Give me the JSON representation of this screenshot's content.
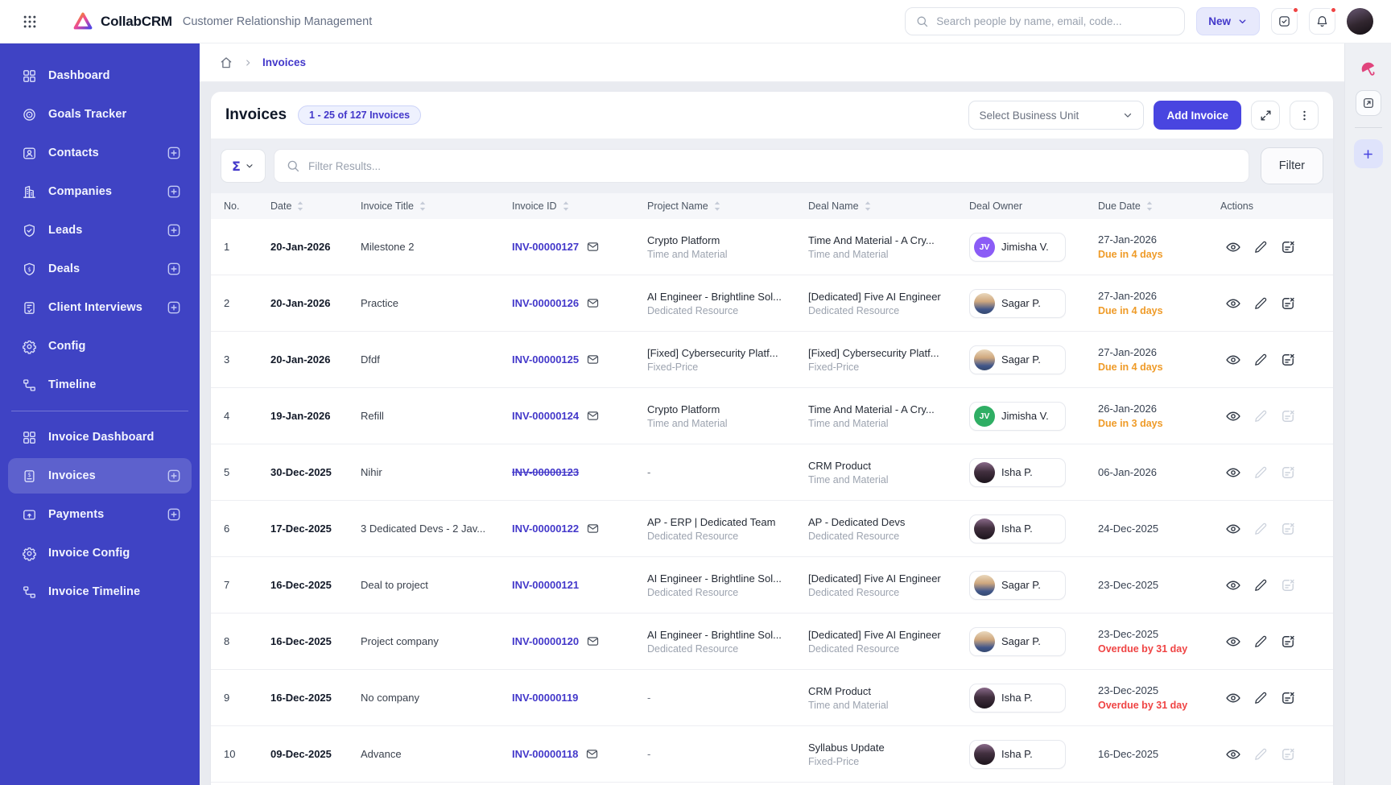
{
  "topbar": {
    "brand": "CollabCRM",
    "tagline": "Customer Relationship Management",
    "search_placeholder": "Search people by name, email, code...",
    "new_label": "New",
    "accent_color": "#4945e0",
    "notification_dot_color": "#ef4444"
  },
  "sidebar": {
    "background_color": "#3f43c4",
    "items": [
      {
        "label": "Dashboard",
        "icon": "dashboard-icon",
        "addable": false,
        "active": false
      },
      {
        "label": "Goals Tracker",
        "icon": "target-icon",
        "addable": false,
        "active": false
      },
      {
        "label": "Contacts",
        "icon": "contact-card-icon",
        "addable": true,
        "active": false
      },
      {
        "label": "Companies",
        "icon": "building-icon",
        "addable": true,
        "active": false
      },
      {
        "label": "Leads",
        "icon": "shield-check-icon",
        "addable": true,
        "active": false
      },
      {
        "label": "Deals",
        "icon": "shield-dollar-icon",
        "addable": true,
        "active": false
      },
      {
        "label": "Client Interviews",
        "icon": "document-check-icon",
        "addable": true,
        "active": false
      },
      {
        "label": "Config",
        "icon": "gear-icon",
        "addable": false,
        "active": false
      },
      {
        "label": "Timeline",
        "icon": "timeline-icon",
        "addable": false,
        "active": false
      },
      {
        "divider": true
      },
      {
        "label": "Invoice Dashboard",
        "icon": "dashboard-icon",
        "addable": false,
        "active": false
      },
      {
        "label": "Invoices",
        "icon": "invoice-icon",
        "addable": true,
        "active": true
      },
      {
        "label": "Payments",
        "icon": "payment-card-icon",
        "addable": true,
        "active": false
      },
      {
        "label": "Invoice Config",
        "icon": "gear-icon",
        "addable": false,
        "active": false
      },
      {
        "label": "Invoice Timeline",
        "icon": "timeline-icon",
        "addable": false,
        "active": false
      }
    ]
  },
  "breadcrumb": {
    "current": "Invoices"
  },
  "toolbar": {
    "title": "Invoices",
    "count_badge": "1 - 25 of 127 Invoices",
    "business_unit_placeholder": "Select Business Unit",
    "add_invoice_label": "Add Invoice"
  },
  "filterbar": {
    "sigma_glyph": "Σ",
    "placeholder": "Filter Results...",
    "filter_label": "Filter"
  },
  "table": {
    "columns": [
      {
        "label": "No.",
        "sortable": false
      },
      {
        "label": "Date",
        "sortable": true
      },
      {
        "label": "Invoice Title",
        "sortable": true
      },
      {
        "label": "Invoice ID",
        "sortable": true
      },
      {
        "label": "Project Name",
        "sortable": true
      },
      {
        "label": "Deal Name",
        "sortable": true
      },
      {
        "label": "Deal Owner",
        "sortable": false
      },
      {
        "label": "Due Date",
        "sortable": true
      },
      {
        "label": "Actions",
        "sortable": false
      }
    ],
    "status_colors": {
      "warn": "#ef9b28",
      "over": "#ef4444"
    },
    "rows": [
      {
        "no": "1",
        "date": "20-Jan-2026",
        "title": "Milestone 2",
        "invoice_id": "INV-00000127",
        "cancelled": false,
        "has_mail": true,
        "project_name": "Crypto Platform",
        "project_type": "Time and Material",
        "deal_name": "Time And Material - A Cry...",
        "deal_type": "Time and Material",
        "owner": {
          "name": "Jimisha V.",
          "avatar": "initials",
          "initials": "JV",
          "color": "#8b5cf6"
        },
        "due_date": "27-Jan-2026",
        "due_status": "Due in 4 days",
        "due_status_type": "warn",
        "actions": {
          "view": true,
          "edit": true,
          "cancel": true
        }
      },
      {
        "no": "2",
        "date": "20-Jan-2026",
        "title": "Practice",
        "invoice_id": "INV-00000126",
        "cancelled": false,
        "has_mail": true,
        "project_name": "AI Engineer - Brightline Sol...",
        "project_type": "Dedicated Resource",
        "deal_name": "[Dedicated] Five AI Engineer",
        "deal_type": "Dedicated Resource",
        "owner": {
          "name": "Sagar P.",
          "avatar": "photo-male"
        },
        "due_date": "27-Jan-2026",
        "due_status": "Due in 4 days",
        "due_status_type": "warn",
        "actions": {
          "view": true,
          "edit": true,
          "cancel": true
        }
      },
      {
        "no": "3",
        "date": "20-Jan-2026",
        "title": "Dfdf",
        "invoice_id": "INV-00000125",
        "cancelled": false,
        "has_mail": true,
        "project_name": "[Fixed] Cybersecurity Platf...",
        "project_type": "Fixed-Price",
        "deal_name": "[Fixed] Cybersecurity Platf...",
        "deal_type": "Fixed-Price",
        "owner": {
          "name": "Sagar P.",
          "avatar": "photo-male"
        },
        "due_date": "27-Jan-2026",
        "due_status": "Due in 4 days",
        "due_status_type": "warn",
        "actions": {
          "view": true,
          "edit": true,
          "cancel": true
        }
      },
      {
        "no": "4",
        "date": "19-Jan-2026",
        "title": "Refill",
        "invoice_id": "INV-00000124",
        "cancelled": false,
        "has_mail": true,
        "project_name": "Crypto Platform",
        "project_type": "Time and Material",
        "deal_name": "Time And Material - A Cry...",
        "deal_type": "Time and Material",
        "owner": {
          "name": "Jimisha V.",
          "avatar": "initials",
          "initials": "JV",
          "color": "#2fae64"
        },
        "due_date": "26-Jan-2026",
        "due_status": "Due in 3 days",
        "due_status_type": "warn",
        "actions": {
          "view": true,
          "edit": false,
          "cancel": false
        }
      },
      {
        "no": "5",
        "date": "30-Dec-2025",
        "title": "Nihir",
        "invoice_id": "INV-00000123",
        "cancelled": true,
        "has_mail": false,
        "project_name": "-",
        "project_type": "",
        "deal_name": "CRM Product",
        "deal_type": "Time and Material",
        "owner": {
          "name": "Isha P.",
          "avatar": "photo-female"
        },
        "due_date": "06-Jan-2026",
        "due_status": "",
        "due_status_type": "",
        "actions": {
          "view": true,
          "edit": false,
          "cancel": false
        }
      },
      {
        "no": "6",
        "date": "17-Dec-2025",
        "title": "3 Dedicated Devs - 2 Jav...",
        "invoice_id": "INV-00000122",
        "cancelled": false,
        "has_mail": true,
        "project_name": "AP - ERP | Dedicated Team",
        "project_type": "Dedicated Resource",
        "deal_name": "AP - Dedicated Devs",
        "deal_type": "Dedicated Resource",
        "owner": {
          "name": "Isha P.",
          "avatar": "photo-female"
        },
        "due_date": "24-Dec-2025",
        "due_status": "",
        "due_status_type": "",
        "actions": {
          "view": true,
          "edit": false,
          "cancel": false
        }
      },
      {
        "no": "7",
        "date": "16-Dec-2025",
        "title": "Deal to project",
        "invoice_id": "INV-00000121",
        "cancelled": false,
        "has_mail": false,
        "project_name": "AI Engineer - Brightline Sol...",
        "project_type": "Dedicated Resource",
        "deal_name": "[Dedicated] Five AI Engineer",
        "deal_type": "Dedicated Resource",
        "owner": {
          "name": "Sagar P.",
          "avatar": "photo-male"
        },
        "due_date": "23-Dec-2025",
        "due_status": "",
        "due_status_type": "",
        "actions": {
          "view": true,
          "edit": true,
          "cancel": false
        }
      },
      {
        "no": "8",
        "date": "16-Dec-2025",
        "title": "Project company",
        "invoice_id": "INV-00000120",
        "cancelled": false,
        "has_mail": true,
        "project_name": "AI Engineer - Brightline Sol...",
        "project_type": "Dedicated Resource",
        "deal_name": "[Dedicated] Five AI Engineer",
        "deal_type": "Dedicated Resource",
        "owner": {
          "name": "Sagar P.",
          "avatar": "photo-male"
        },
        "due_date": "23-Dec-2025",
        "due_status": "Overdue by 31 day",
        "due_status_type": "over",
        "actions": {
          "view": true,
          "edit": true,
          "cancel": true
        }
      },
      {
        "no": "9",
        "date": "16-Dec-2025",
        "title": "No company",
        "invoice_id": "INV-00000119",
        "cancelled": false,
        "has_mail": false,
        "project_name": "-",
        "project_type": "",
        "deal_name": "CRM Product",
        "deal_type": "Time and Material",
        "owner": {
          "name": "Isha P.",
          "avatar": "photo-female"
        },
        "due_date": "23-Dec-2025",
        "due_status": "Overdue by 31 day",
        "due_status_type": "over",
        "actions": {
          "view": true,
          "edit": true,
          "cancel": true
        }
      },
      {
        "no": "10",
        "date": "09-Dec-2025",
        "title": "Advance",
        "invoice_id": "INV-00000118",
        "cancelled": false,
        "has_mail": true,
        "project_name": "-",
        "project_type": "",
        "deal_name": "Syllabus Update",
        "deal_type": "Fixed-Price",
        "owner": {
          "name": "Isha P.",
          "avatar": "photo-female"
        },
        "due_date": "16-Dec-2025",
        "due_status": "",
        "due_status_type": "",
        "actions": {
          "view": true,
          "edit": false,
          "cancel": false
        }
      }
    ]
  },
  "rail": {
    "umbrella_color": "#e0447c",
    "plus_label": "+"
  }
}
